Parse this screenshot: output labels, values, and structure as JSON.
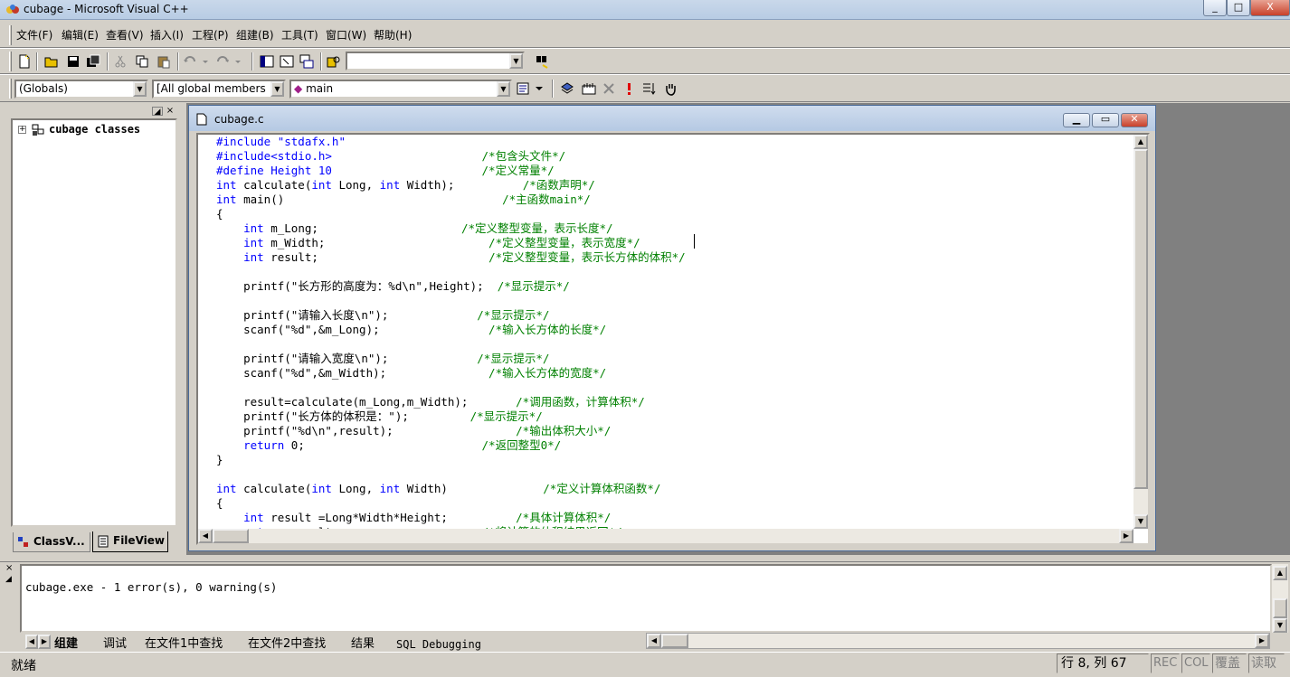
{
  "window": {
    "title": "cubage - Microsoft Visual C++",
    "minimize": "_",
    "maximize": "□",
    "close": "X"
  },
  "menu": [
    "文件(F)",
    "编辑(E)",
    "查看(V)",
    "插入(I)",
    "工程(P)",
    "组建(B)",
    "工具(T)",
    "窗口(W)",
    "帮助(H)"
  ],
  "toolbar": {
    "find_value": ""
  },
  "wizardbar": {
    "class_combo": "(Globals)",
    "filter_combo": "[All global members",
    "member_combo": "main"
  },
  "workspace": {
    "tree_root": "cubage classes",
    "tabs": [
      "ClassV...",
      "FileView"
    ]
  },
  "editor": {
    "filename": "cubage.c",
    "lines": [
      [
        {
          "t": "#include \"stdafx.h\"",
          "c": "kw1"
        }
      ],
      [
        {
          "t": "#include<stdio.h>",
          "c": "kw1"
        },
        {
          "t": "                      "
        },
        {
          "t": "/*包含头文件*/",
          "c": "cm"
        }
      ],
      [
        {
          "t": "#define Height 10",
          "c": "kw1"
        },
        {
          "t": "                      "
        },
        {
          "t": "/*定义常量*/",
          "c": "cm"
        }
      ],
      [
        {
          "t": "int",
          "c": "kw"
        },
        {
          "t": " calculate("
        },
        {
          "t": "int",
          "c": "kw"
        },
        {
          "t": " Long, "
        },
        {
          "t": "int",
          "c": "kw"
        },
        {
          "t": " Width);"
        },
        {
          "t": "          "
        },
        {
          "t": "/*函数声明*/",
          "c": "cm"
        }
      ],
      [
        {
          "t": "int",
          "c": "kw"
        },
        {
          "t": " main()"
        },
        {
          "t": "                                "
        },
        {
          "t": "/*主函数main*/",
          "c": "cm"
        }
      ],
      [
        {
          "t": "{"
        }
      ],
      [
        {
          "t": "    "
        },
        {
          "t": "int",
          "c": "kw"
        },
        {
          "t": " m_Long;"
        },
        {
          "t": "                     "
        },
        {
          "t": "/*定义整型变量，表示长度*/",
          "c": "cm"
        }
      ],
      [
        {
          "t": "    "
        },
        {
          "t": "int",
          "c": "kw"
        },
        {
          "t": " m_Width;"
        },
        {
          "t": "                        "
        },
        {
          "t": "/*定义整型变量，表示宽度*/",
          "c": "cm"
        }
      ],
      [
        {
          "t": "    "
        },
        {
          "t": "int",
          "c": "kw"
        },
        {
          "t": " result;"
        },
        {
          "t": "                         "
        },
        {
          "t": "/*定义整型变量，表示长方体的体积*/",
          "c": "cm"
        }
      ],
      [
        {
          "t": ""
        }
      ],
      [
        {
          "t": "    printf(\"长方形的高度为：%d\\n\",Height);  "
        },
        {
          "t": "/*显示提示*/",
          "c": "cm"
        }
      ],
      [
        {
          "t": ""
        }
      ],
      [
        {
          "t": "    printf(\"请输入长度\\n\");"
        },
        {
          "t": "             "
        },
        {
          "t": "/*显示提示*/",
          "c": "cm"
        }
      ],
      [
        {
          "t": "    scanf(\"%d\",&m_Long);"
        },
        {
          "t": "                "
        },
        {
          "t": "/*输入长方体的长度*/",
          "c": "cm"
        }
      ],
      [
        {
          "t": ""
        }
      ],
      [
        {
          "t": "    printf(\"请输入宽度\\n\");"
        },
        {
          "t": "             "
        },
        {
          "t": "/*显示提示*/",
          "c": "cm"
        }
      ],
      [
        {
          "t": "    scanf(\"%d\",&m_Width);"
        },
        {
          "t": "               "
        },
        {
          "t": "/*输入长方体的宽度*/",
          "c": "cm"
        }
      ],
      [
        {
          "t": ""
        }
      ],
      [
        {
          "t": "    result=calculate(m_Long,m_Width);"
        },
        {
          "t": "       "
        },
        {
          "t": "/*调用函数，计算体积*/",
          "c": "cm"
        }
      ],
      [
        {
          "t": "    printf(\"长方体的体积是：\");"
        },
        {
          "t": "         "
        },
        {
          "t": "/*显示提示*/",
          "c": "cm"
        }
      ],
      [
        {
          "t": "    printf(\"%d\\n\",result);"
        },
        {
          "t": "                  "
        },
        {
          "t": "/*输出体积大小*/",
          "c": "cm"
        }
      ],
      [
        {
          "t": "    "
        },
        {
          "t": "return",
          "c": "kw"
        },
        {
          "t": " 0;"
        },
        {
          "t": "                          "
        },
        {
          "t": "/*返回整型0*/",
          "c": "cm"
        }
      ],
      [
        {
          "t": "}"
        }
      ],
      [
        {
          "t": ""
        }
      ],
      [
        {
          "t": "int",
          "c": "kw"
        },
        {
          "t": " calculate("
        },
        {
          "t": "int",
          "c": "kw"
        },
        {
          "t": " Long, "
        },
        {
          "t": "int",
          "c": "kw"
        },
        {
          "t": " Width)"
        },
        {
          "t": "              "
        },
        {
          "t": "/*定义计算体积函数*/",
          "c": "cm"
        }
      ],
      [
        {
          "t": "{"
        }
      ],
      [
        {
          "t": "    "
        },
        {
          "t": "int",
          "c": "kw"
        },
        {
          "t": " result =Long*Width*Height;"
        },
        {
          "t": "          "
        },
        {
          "t": "/*具体计算体积*/",
          "c": "cm"
        }
      ],
      [
        {
          "t": "    "
        },
        {
          "t": "return",
          "c": "kw"
        },
        {
          "t": " result;"
        },
        {
          "t": "                     "
        },
        {
          "t": "/*将计算的体积结果返回*/",
          "c": "cm"
        }
      ]
    ]
  },
  "output": {
    "text": "cubage.exe - 1 error(s), 0 warning(s)",
    "tabs": [
      "组建",
      "调试",
      "在文件1中查找",
      "在文件2中查找",
      "结果",
      "SQL Debugging"
    ]
  },
  "status": {
    "ready": "就绪",
    "position": "行 8, 列 67",
    "rec": "REC",
    "col": "COL",
    "ovr": "覆盖",
    "read": "读取"
  },
  "colors": {
    "keyword": "#0000ff",
    "comment": "#008000",
    "workspace_bg": "#808080"
  }
}
